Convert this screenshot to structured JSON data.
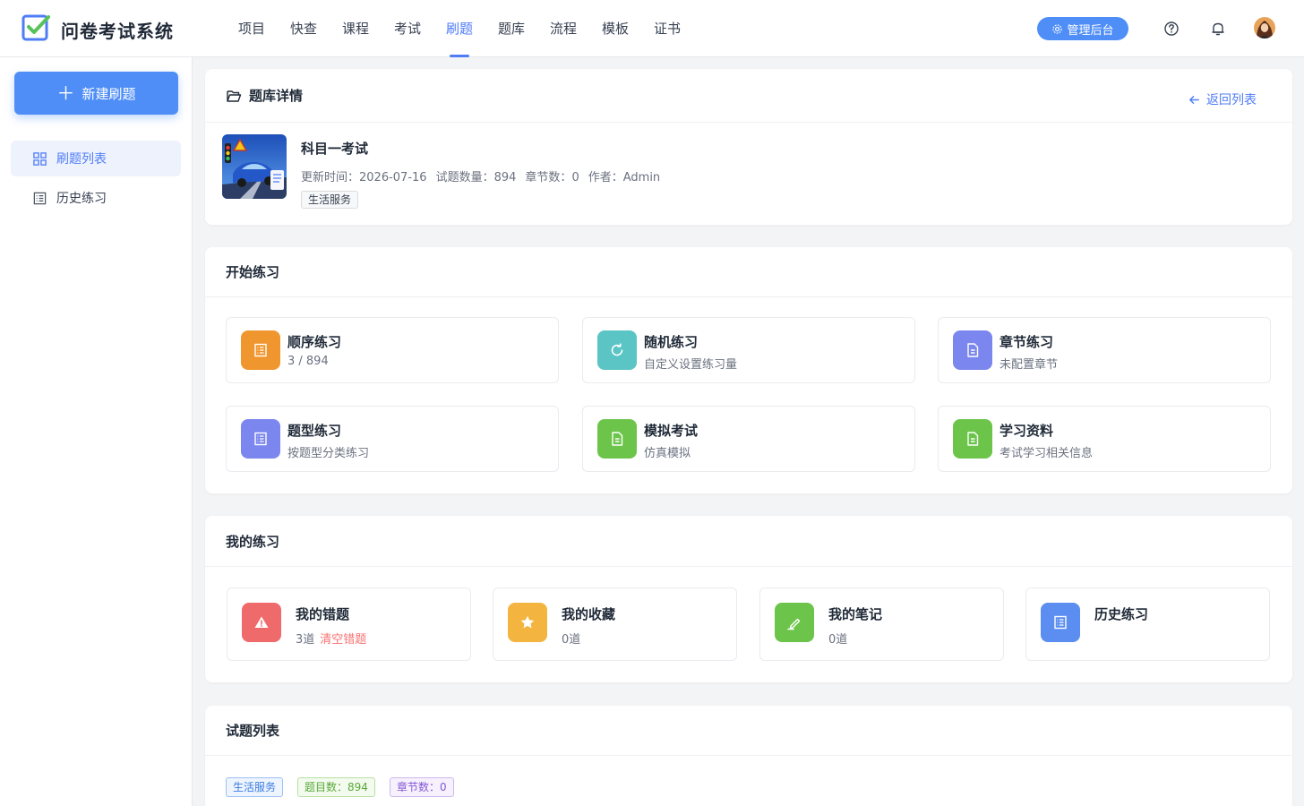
{
  "app": {
    "title": "问卷考试系统",
    "logo_icon": "checkbox-logo-icon"
  },
  "nav": {
    "items": [
      {
        "label": "项目"
      },
      {
        "label": "快查"
      },
      {
        "label": "课程"
      },
      {
        "label": "考试"
      },
      {
        "label": "刷题",
        "active": true
      },
      {
        "label": "题库"
      },
      {
        "label": "流程"
      },
      {
        "label": "模板"
      },
      {
        "label": "证书"
      }
    ],
    "admin_label": "管理后台",
    "accent": "#4f7cf7"
  },
  "sidebar": {
    "new_button_label": "新建刷题",
    "items": [
      {
        "label": "刷题列表",
        "icon": "grid-icon",
        "active": true
      },
      {
        "label": "历史练习",
        "icon": "list-icon"
      }
    ]
  },
  "bank": {
    "section_title": "题库详情",
    "back_label": "返回列表",
    "name": "科目一考试",
    "meta": {
      "updated_label": "更新时间：",
      "updated": "2026-07-16",
      "count_label": "试题数量：",
      "count": "894",
      "chapters_label": "章节数：",
      "chapters": "0",
      "author_label": "作者：",
      "author": "Admin"
    },
    "tag": "生活服务"
  },
  "practice": {
    "section_title": "开始练习",
    "tiles": [
      {
        "title": "顺序练习",
        "subtitle": "3 / 894",
        "color": "#f0962e",
        "icon": "list-icon"
      },
      {
        "title": "随机练习",
        "subtitle": "自定义设置练习量",
        "color": "#5bc4c4",
        "icon": "refresh-icon"
      },
      {
        "title": "章节练习",
        "subtitle": "未配置章节",
        "color": "#7b86ee",
        "icon": "document-icon"
      },
      {
        "title": "题型练习",
        "subtitle": "按题型分类练习",
        "color": "#7b86ee",
        "icon": "list-icon"
      },
      {
        "title": "模拟考试",
        "subtitle": "仿真模拟",
        "color": "#6cc54a",
        "icon": "document-icon"
      },
      {
        "title": "学习资料",
        "subtitle": "考试学习相关信息",
        "color": "#6cc54a",
        "icon": "document-icon"
      }
    ]
  },
  "mine": {
    "section_title": "我的练习",
    "tiles": [
      {
        "title": "我的错题",
        "subtitle": "3道",
        "action": "清空错题",
        "color": "#ef6a6a",
        "icon": "warning-icon"
      },
      {
        "title": "我的收藏",
        "subtitle": "0道",
        "color": "#f3b53f",
        "icon": "star-icon"
      },
      {
        "title": "我的笔记",
        "subtitle": "0道",
        "color": "#6cc54a",
        "icon": "pen-icon"
      },
      {
        "title": "历史练习",
        "subtitle": "",
        "color": "#5b8ef0",
        "icon": "list-icon"
      }
    ]
  },
  "questions": {
    "section_title": "试题列表",
    "badges": {
      "category": "生活服务",
      "count": "题目数：894",
      "chapters": "章节数：0"
    }
  }
}
